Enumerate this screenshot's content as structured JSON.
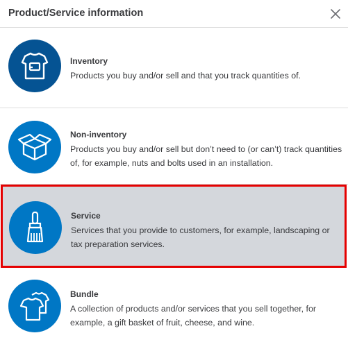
{
  "header": {
    "title": "Product/Service information"
  },
  "options": [
    {
      "title": "Inventory",
      "description": "Products you buy and/or sell and that you track quantities of.",
      "icon": "tshirt-box-icon",
      "icon_color": "#055393"
    },
    {
      "title": "Non-inventory",
      "description": "Products you buy and/or sell but don’t need to (or can’t) track quantities of, for example, nuts and bolts used in an installation.",
      "icon": "open-box-icon",
      "icon_color": "#0077c5"
    },
    {
      "title": "Service",
      "description": "Services that you provide to customers, for example, landscaping or tax preparation services.",
      "icon": "paintbrush-icon",
      "icon_color": "#0077c5",
      "selected": true
    },
    {
      "title": "Bundle",
      "description": "A collection of products and/or services that you sell together, for example, a gift basket of fruit, cheese, and wine.",
      "icon": "shirts-bundle-icon",
      "icon_color": "#0077c5"
    }
  ],
  "colors": {
    "selection_border": "#e50000",
    "selection_background": "#d4d7dc",
    "divider": "#dcdcdc"
  }
}
